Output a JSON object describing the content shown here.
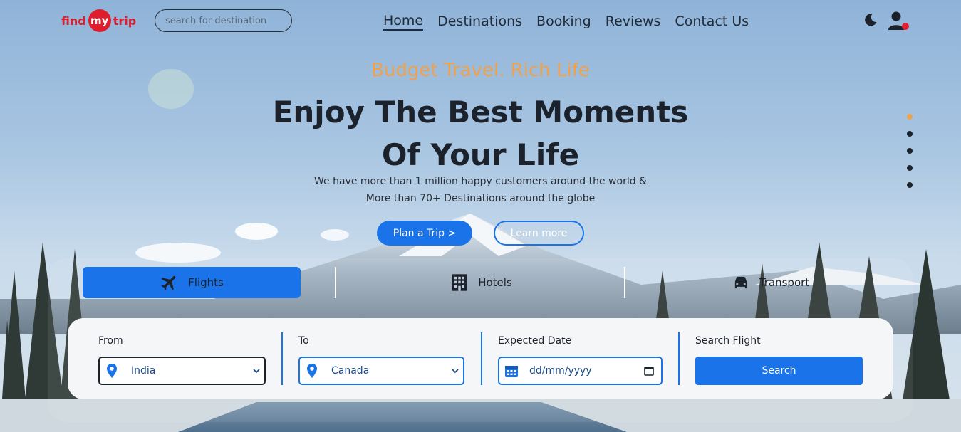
{
  "brand": {
    "logo_left": "find",
    "logo_mid": "my",
    "logo_right": "trip"
  },
  "search": {
    "placeholder": "search for destination"
  },
  "nav": {
    "items": [
      {
        "label": "Home",
        "active": true
      },
      {
        "label": "Destinations",
        "active": false
      },
      {
        "label": "Booking",
        "active": false
      },
      {
        "label": "Reviews",
        "active": false
      },
      {
        "label": "Contact Us",
        "active": false
      }
    ]
  },
  "icons": {
    "theme": "moon-icon",
    "account": "user-icon",
    "notification_color": "#e01d2c"
  },
  "hero": {
    "tagline": "Budget Travel. Rich Life",
    "headline_line1": "Enjoy The Best Moments",
    "headline_line2": "Of Your Life",
    "sub_line1": "We have more than 1 million happy customers around the world &",
    "sub_line2": "More than 70+ Destinations around the globe",
    "primary_button": "Plan a Trip >",
    "secondary_button": "Learn more"
  },
  "slider": {
    "count": 5,
    "active_index": 0
  },
  "tabs": [
    {
      "label": "Flights",
      "icon": "plane-icon",
      "active": true
    },
    {
      "label": "Hotels",
      "icon": "building-icon",
      "active": false
    },
    {
      "label": "Transport",
      "icon": "car-icon",
      "active": false
    }
  ],
  "form": {
    "from": {
      "label": "From",
      "value": "India",
      "icon": "location-pin-icon"
    },
    "to": {
      "label": "To",
      "value": "Canada",
      "icon": "location-pin-icon"
    },
    "date": {
      "label": "Expected Date",
      "placeholder": "dd/mm/yyyy",
      "icon": "calendar-icon"
    },
    "submit": {
      "label": "Search Flight",
      "button": "Search"
    }
  },
  "colors": {
    "accent": "#1a73e8",
    "tagline": "#f0a14a",
    "brand": "#e01d2c",
    "text": "#1c222b"
  }
}
